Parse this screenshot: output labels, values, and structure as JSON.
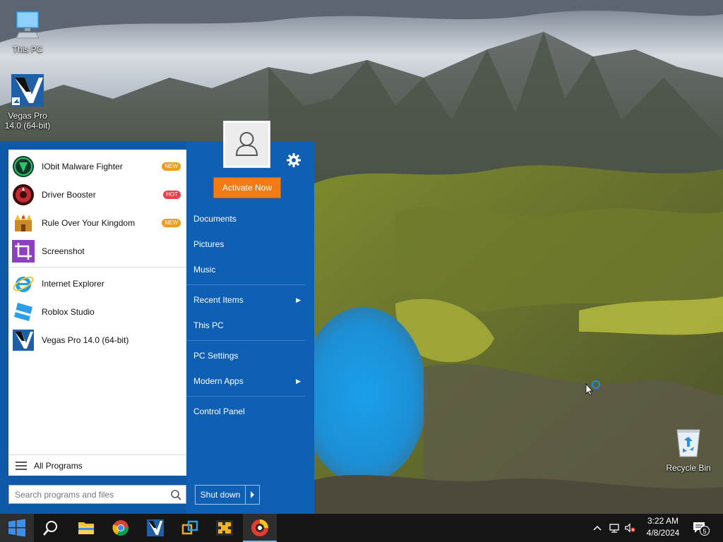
{
  "desktop": {
    "icons": [
      {
        "label_line1": "This PC",
        "label_line2": ""
      },
      {
        "label_line1": "Vegas Pro",
        "label_line2": "14.0 (64-bit)"
      },
      {
        "label_line1": "Recycle Bin",
        "label_line2": ""
      }
    ]
  },
  "start_menu": {
    "apps": [
      {
        "label": "IObit Malware Fighter",
        "badge": "NEW",
        "icon": "iobit-malware-fighter-icon"
      },
      {
        "label": "Driver Booster",
        "badge": "HOT",
        "icon": "driver-booster-icon"
      },
      {
        "label": "Rule Over Your Kingdom",
        "badge": "NEW",
        "icon": "kingdom-game-icon"
      },
      {
        "label": "Screenshot",
        "badge": "",
        "icon": "screenshot-crop-icon"
      },
      {
        "label": "Internet Explorer",
        "badge": "",
        "icon": "internet-explorer-icon"
      },
      {
        "label": "Roblox Studio",
        "badge": "",
        "icon": "roblox-studio-icon"
      },
      {
        "label": "Vegas Pro 14.0 (64-bit)",
        "badge": "",
        "icon": "vegas-pro-icon"
      }
    ],
    "all_programs": "All Programs",
    "search_placeholder": "Search programs and files",
    "activate_label": "Activate Now",
    "shutdown_label": "Shut down",
    "right_items": [
      {
        "label": "Documents",
        "submenu": false
      },
      {
        "label": "Pictures",
        "submenu": false
      },
      {
        "label": "Music",
        "submenu": false
      },
      {
        "label": "Recent Items",
        "submenu": true
      },
      {
        "label": "This PC",
        "submenu": false
      },
      {
        "label": "PC Settings",
        "submenu": false
      },
      {
        "label": "Modern Apps",
        "submenu": true
      },
      {
        "label": "Control Panel",
        "submenu": false
      }
    ]
  },
  "taskbar": {
    "pinned": [
      "windows-start-icon",
      "search-icon",
      "file-explorer-icon",
      "chrome-icon",
      "vegas-pro-icon",
      "network-tool-icon",
      "iobit-tool-icon",
      "driver-booster-icon"
    ],
    "clock_time": "3:22 AM",
    "clock_date": "4/8/2024",
    "notification_count": "5"
  },
  "colors": {
    "start_left": "#0e5aa8",
    "start_right": "#0f5fb4",
    "activate": "#f27b13",
    "badge_new": "#f29a1a",
    "badge_hot": "#e8414a",
    "taskbar": "#161616"
  }
}
